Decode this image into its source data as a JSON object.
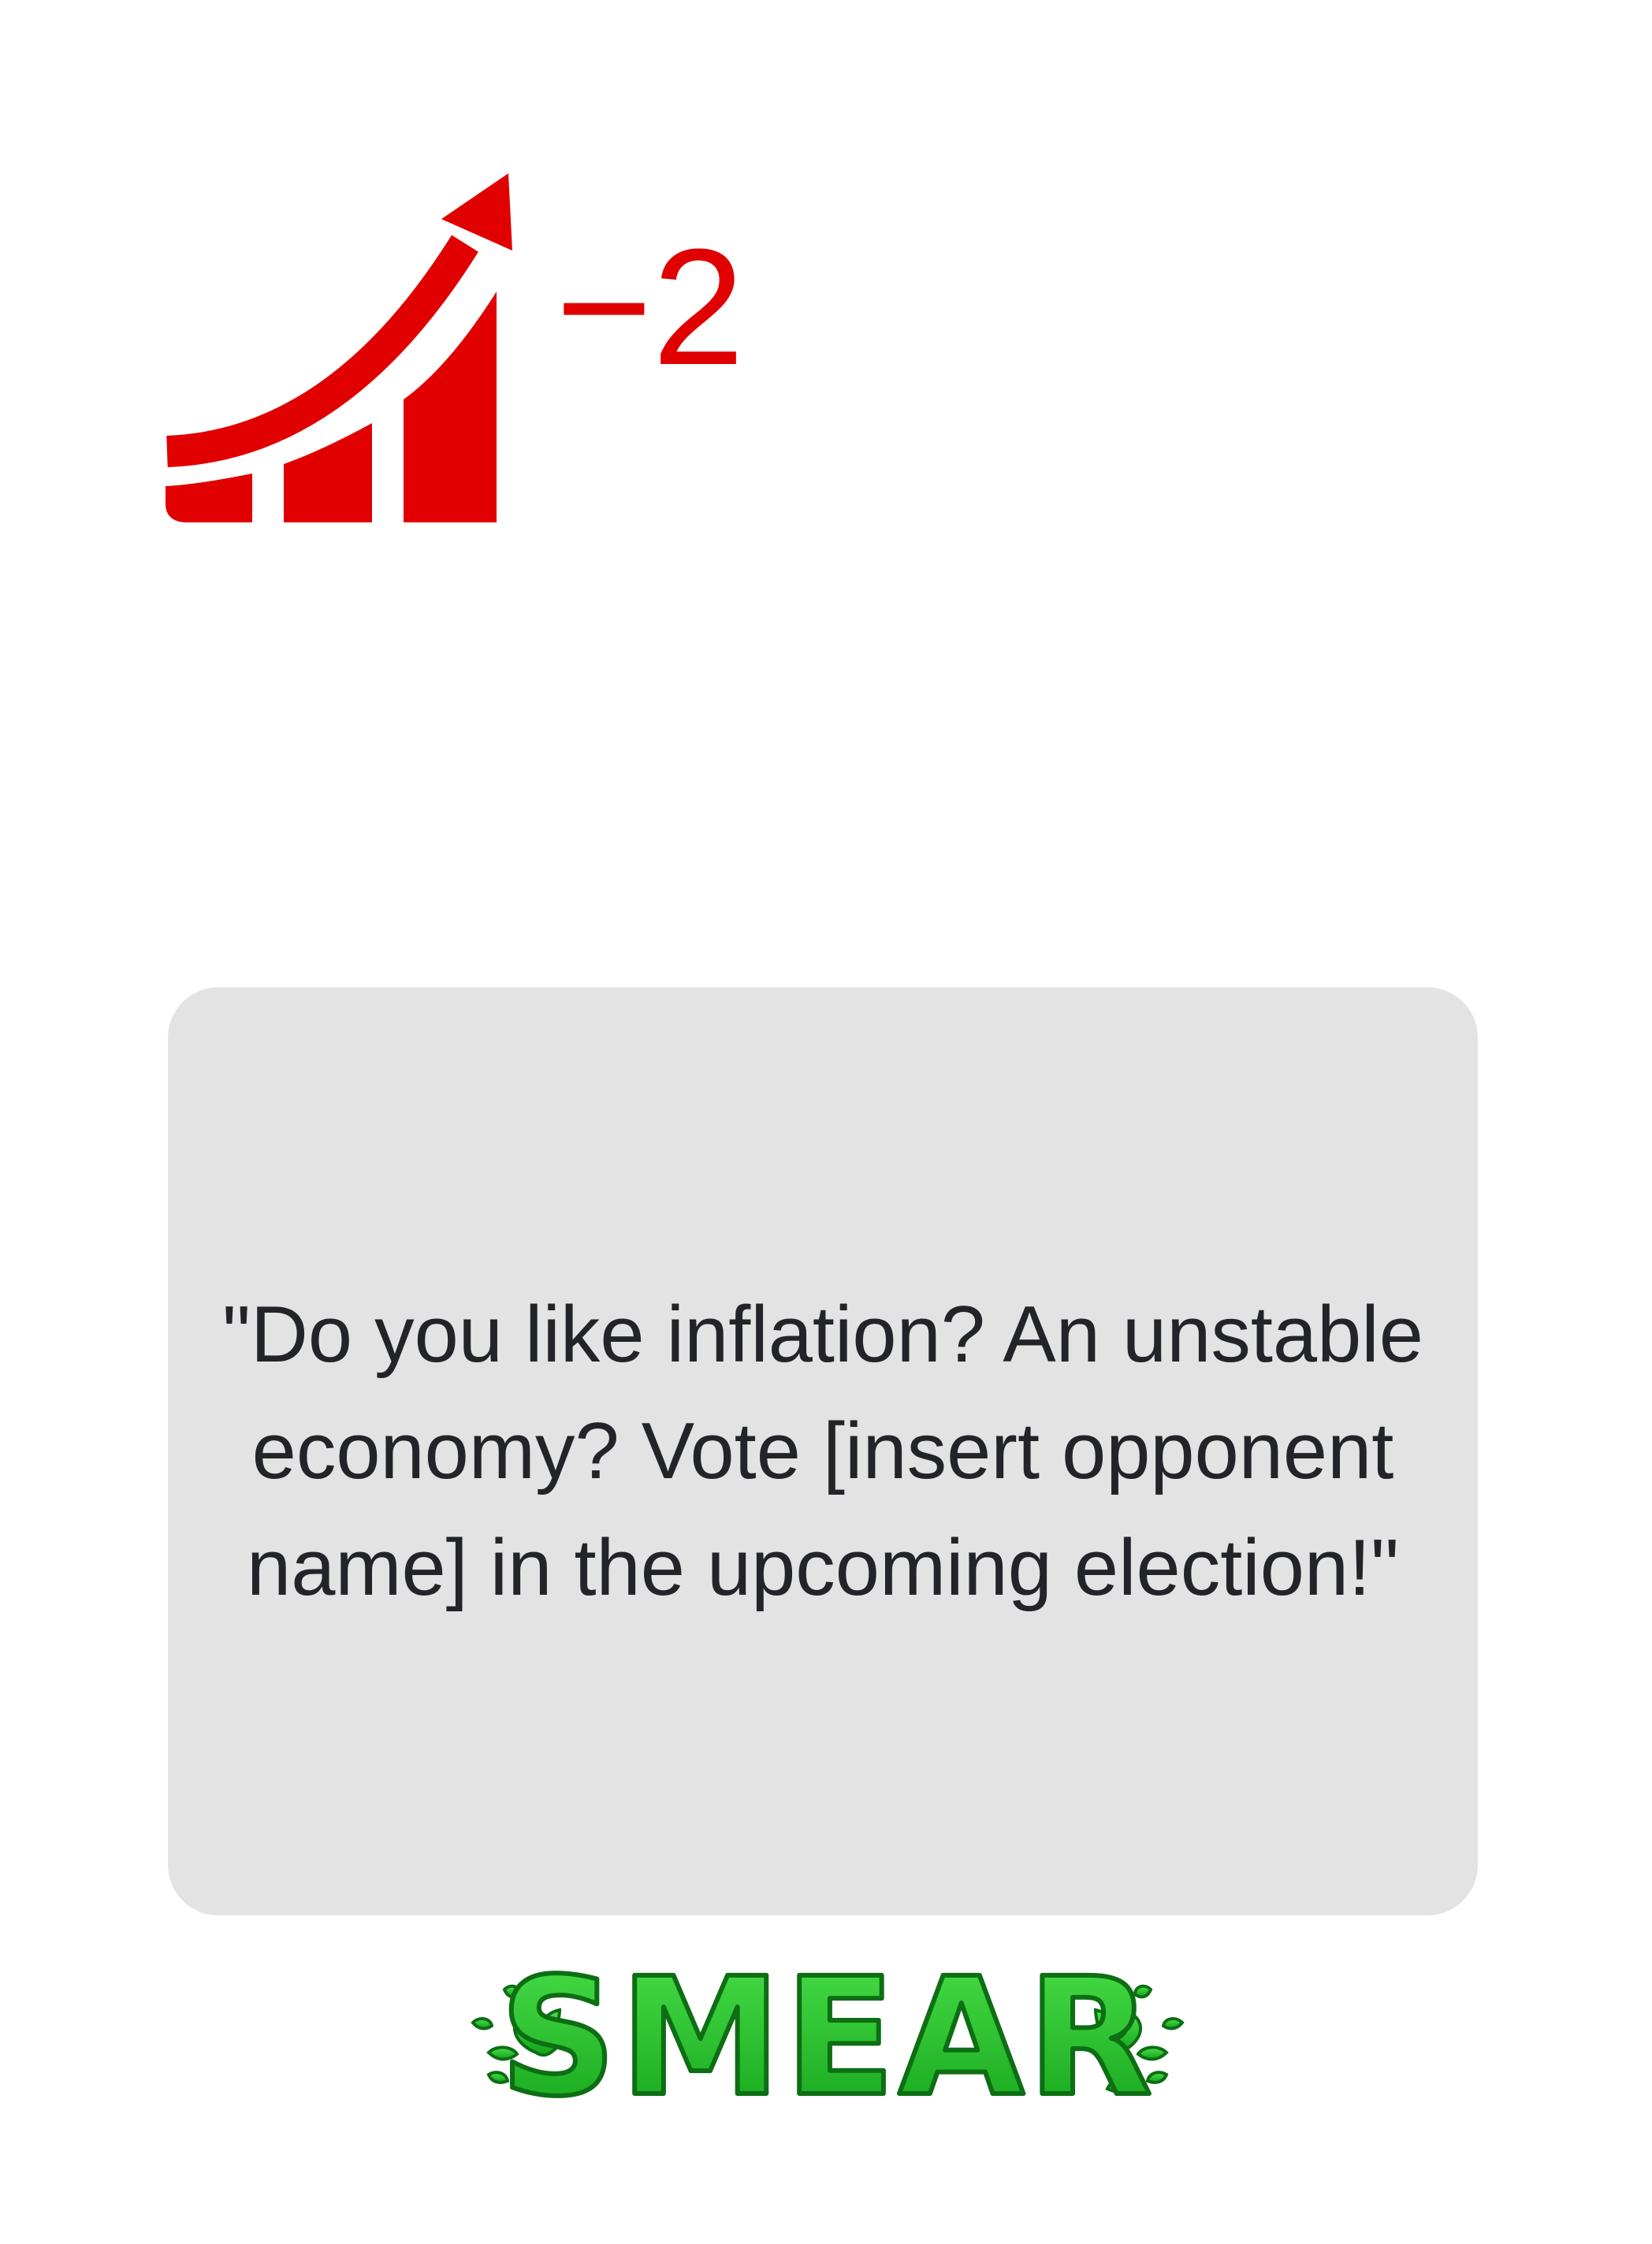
{
  "card": {
    "stat": {
      "icon": "rising-chart-arrow-icon",
      "value": "−2",
      "color": "#e10000"
    },
    "quote": "\"Do you like inflation? An unstable economy? Vote [insert opponent name] in the upcoming election!\"",
    "brand": {
      "logo_text": "SMEAR",
      "color": "#22c41e"
    }
  }
}
